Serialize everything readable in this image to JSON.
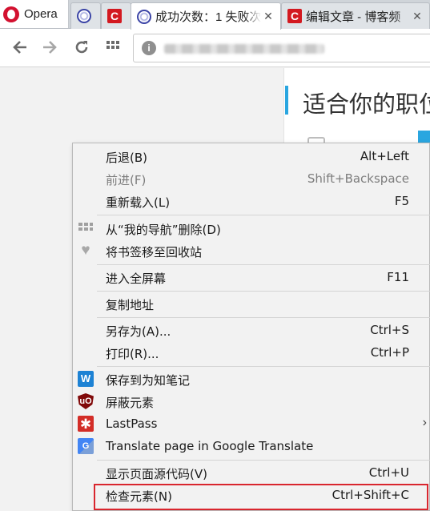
{
  "browser": {
    "app_name": "Opera",
    "tabs": [
      {
        "title": "",
        "favicon": "globe-favicon",
        "close": ""
      },
      {
        "title": "",
        "favicon": "c-favicon",
        "close": ""
      },
      {
        "title": "成功次数：1 失败次",
        "favicon": "globe-favicon",
        "close": "✕"
      },
      {
        "title": "编辑文章 - 博客频",
        "favicon": "c-favicon",
        "close": "✕"
      }
    ],
    "address_bar": {
      "icon": "info-icon",
      "url_visible": ""
    }
  },
  "page": {
    "heading": "适合你的职位"
  },
  "context_menu": {
    "items": [
      {
        "label": "后退(B)",
        "shortcut": "Alt+Left",
        "icon": ""
      },
      {
        "label": "前进(F)",
        "shortcut": "Shift+Backspace",
        "icon": "",
        "disabled": true
      },
      {
        "label": "重新载入(L)",
        "shortcut": "F5",
        "icon": ""
      },
      {
        "label": "从“我的导航”删除(D)",
        "shortcut": "",
        "icon": "speed-dial-grid-icon"
      },
      {
        "label": "将书签移至回收站",
        "shortcut": "",
        "icon": "heart-icon"
      },
      {
        "label": "进入全屏幕",
        "shortcut": "F11",
        "icon": ""
      },
      {
        "label": "复制地址",
        "shortcut": "",
        "icon": ""
      },
      {
        "label": "另存为(A)...",
        "shortcut": "Ctrl+S",
        "icon": ""
      },
      {
        "label": "打印(R)...",
        "shortcut": "Ctrl+P",
        "icon": ""
      },
      {
        "label": "保存到为知笔记",
        "shortcut": "",
        "icon": "wiznote-icon"
      },
      {
        "label": "屏蔽元素",
        "shortcut": "",
        "icon": "ublock-icon"
      },
      {
        "label": "LastPass",
        "shortcut": "",
        "icon": "lastpass-icon",
        "submenu": "›"
      },
      {
        "label": "Translate page in Google Translate",
        "shortcut": "",
        "icon": "google-translate-icon"
      },
      {
        "label": "显示页面源代码(V)",
        "shortcut": "Ctrl+U",
        "icon": ""
      },
      {
        "label": "检查元素(N)",
        "shortcut": "Ctrl+Shift+C",
        "icon": "",
        "highlighted": true
      }
    ]
  },
  "colors": {
    "opera_red": "#d3102f",
    "highlight_border": "#d9262e",
    "panel_accent": "#2aa6e0"
  }
}
